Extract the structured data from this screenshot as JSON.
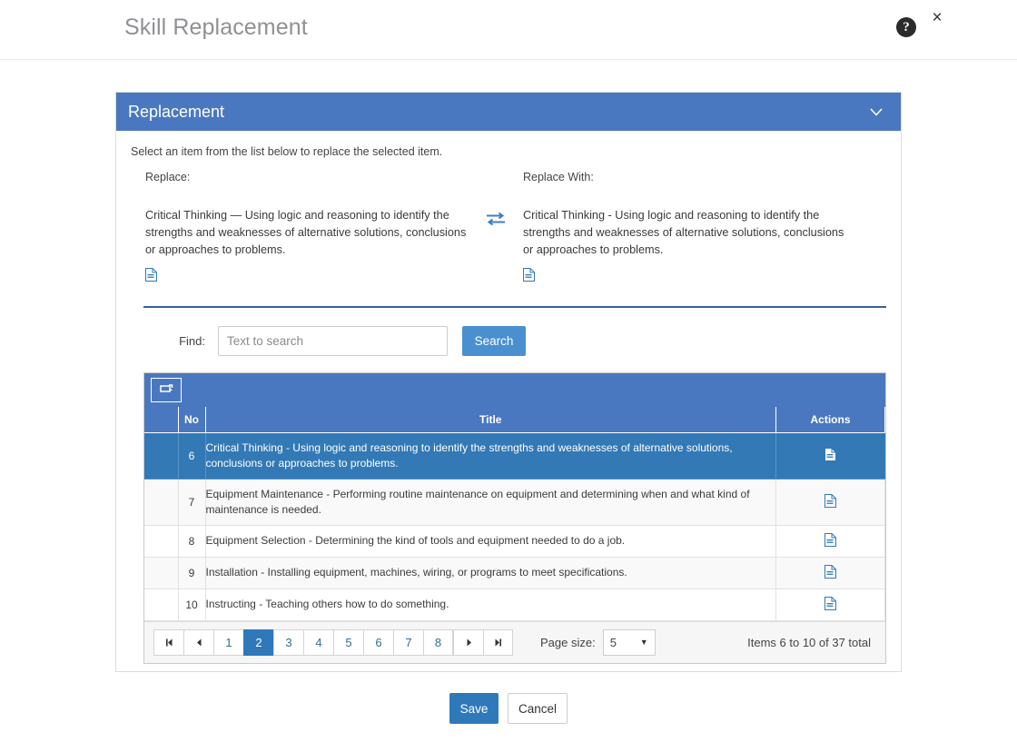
{
  "header": {
    "title": "Skill Replacement",
    "help_glyph": "?",
    "close_glyph": "×"
  },
  "panel": {
    "title": "Replacement",
    "intro": "Select an item from the list below to replace the selected item.",
    "replace_label": "Replace:",
    "replace_text": "Critical Thinking — Using logic and reasoning to identify the strengths and weaknesses of alternative solutions, conclusions or approaches to problems.",
    "replace_with_label": "Replace With:",
    "replace_with_text": "Critical Thinking - Using logic and reasoning to identify the strengths and weaknesses of alternative solutions, conclusions or approaches to problems."
  },
  "search": {
    "label": "Find:",
    "placeholder": "Text to search",
    "value": "",
    "button": "Search"
  },
  "grid": {
    "columns": [
      "",
      "No",
      "Title",
      "Actions"
    ],
    "rows": [
      {
        "no": "6",
        "title": "Critical Thinking - Using logic and reasoning to identify the strengths and weaknesses of alternative solutions, conclusions or approaches to problems.",
        "selected": true
      },
      {
        "no": "7",
        "title": "Equipment Maintenance - Performing routine maintenance on equipment and determining when and what kind of maintenance is needed.",
        "selected": false
      },
      {
        "no": "8",
        "title": "Equipment Selection - Determining the kind of tools and equipment needed to do a job.",
        "selected": false
      },
      {
        "no": "9",
        "title": "Installation - Installing equipment, machines, wiring, or programs to meet specifications.",
        "selected": false
      },
      {
        "no": "10",
        "title": "Instructing - Teaching others how to do something.",
        "selected": false
      }
    ]
  },
  "pager": {
    "first": "⏮",
    "prev": "◄",
    "pages": [
      "1",
      "2",
      "3",
      "4",
      "5",
      "6",
      "7",
      "8"
    ],
    "active_page": "2",
    "next": "►",
    "last": "⏭",
    "page_size_label": "Page size:",
    "page_size_value": "5",
    "caret": "▼",
    "info": "Items 6 to 10 of 37 total"
  },
  "footer": {
    "save": "Save",
    "cancel": "Cancel"
  },
  "colors": {
    "panel_header": "#4a78c0",
    "selected_row": "#3279b6",
    "primary_button": "#2f79ba",
    "search_button": "#4a90d0"
  }
}
